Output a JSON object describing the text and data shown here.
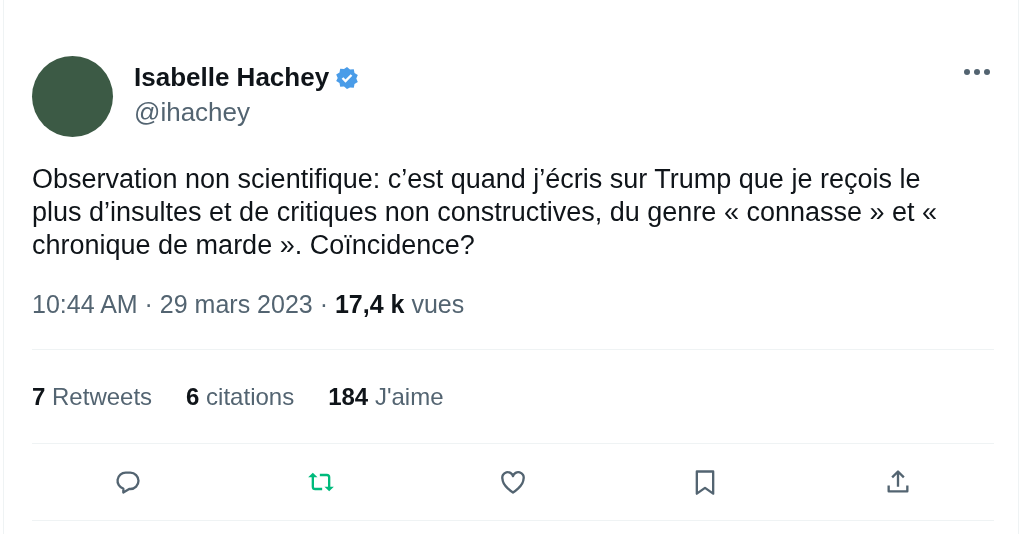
{
  "author": {
    "name": "Isabelle Hachey",
    "handle": "@ihachey",
    "verified": true
  },
  "text": "Observation non scientifique: c’est quand j’écris sur Trump que je reçois le plus d’insultes et de critiques non constructives, du genre « connasse » et « chronique de marde ». Coïncidence?",
  "meta": "10:44 AM · 29 mars 2023 · **17,4 k** vues",
  "stats": [
    {
      "count": "7",
      "label": "Retweets"
    },
    {
      "count": "6",
      "label": "citations"
    },
    {
      "count": "184",
      "label": "J'aime"
    }
  ],
  "actions": [
    {
      "kind": "reply",
      "active": false
    },
    {
      "kind": "retweet",
      "active": true
    },
    {
      "kind": "like",
      "active": false
    },
    {
      "kind": "bookmark",
      "active": false
    },
    {
      "kind": "share",
      "active": false
    }
  ]
}
